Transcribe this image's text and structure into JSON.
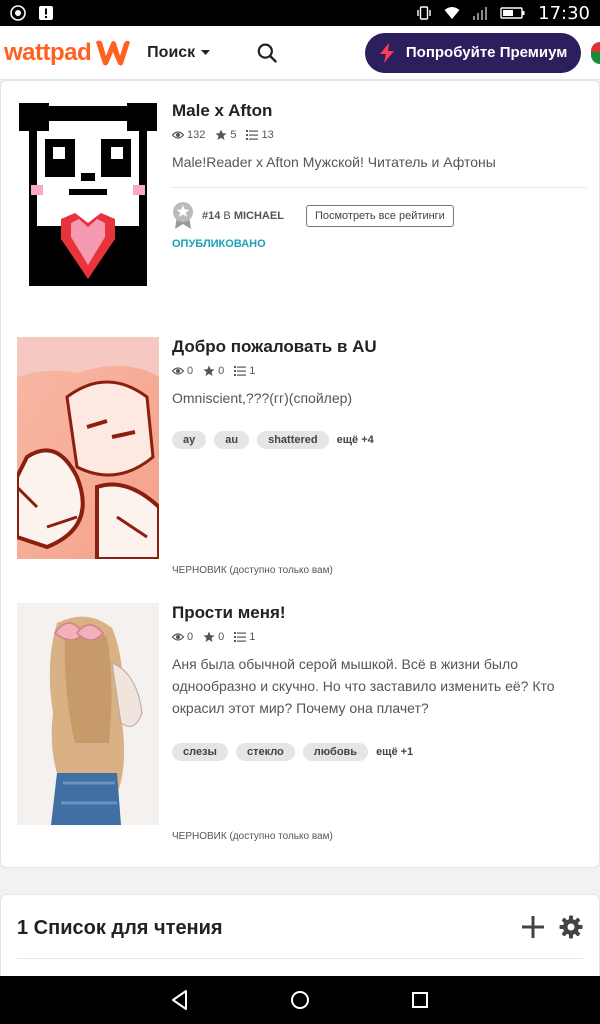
{
  "status_bar": {
    "time": "17:30"
  },
  "header": {
    "logo_text": "wattpad",
    "search_menu_label": "Поиск",
    "premium_label": "Попробуйте Премиум"
  },
  "stories": [
    {
      "title": "Male x Afton",
      "views": "132",
      "votes": "5",
      "parts": "13",
      "description": "Male!Reader x Afton Мужской! Читатель и Афтоны",
      "rank_number": "#14",
      "rank_in": "В",
      "rank_tag": "MICHAEL",
      "rank_button": "Посмотреть все рейтинги",
      "status": "ОПУБЛИКОВАНО"
    },
    {
      "title": "Добро пожаловать в AU",
      "views": "0",
      "votes": "0",
      "parts": "1",
      "description": "Omniscient,???(гг)(спойлер)",
      "tags": [
        "ay",
        "au",
        "shattered"
      ],
      "more_tags": "ещё +4",
      "status": "ЧЕРНОВИК (доступно только вам)"
    },
    {
      "title": "Прости меня!",
      "views": "0",
      "votes": "0",
      "parts": "1",
      "description": "Аня была обычной серой мышкой. Всё в жизни было однообразно и скучно. Но что заставило изменить её? Кто окрасил этот мир? Почему она плачет?",
      "tags": [
        "слезы",
        "стекло",
        "любовь"
      ],
      "more_tags": "ещё +1",
      "status": "ЧЕРНОВИК (доступно только вам)"
    }
  ],
  "reading_list": {
    "title": "1 Список для чтения"
  },
  "colors": {
    "brand": "#ff6122",
    "premium_bg": "#2d1e5e",
    "published": "#1aa1b5"
  }
}
